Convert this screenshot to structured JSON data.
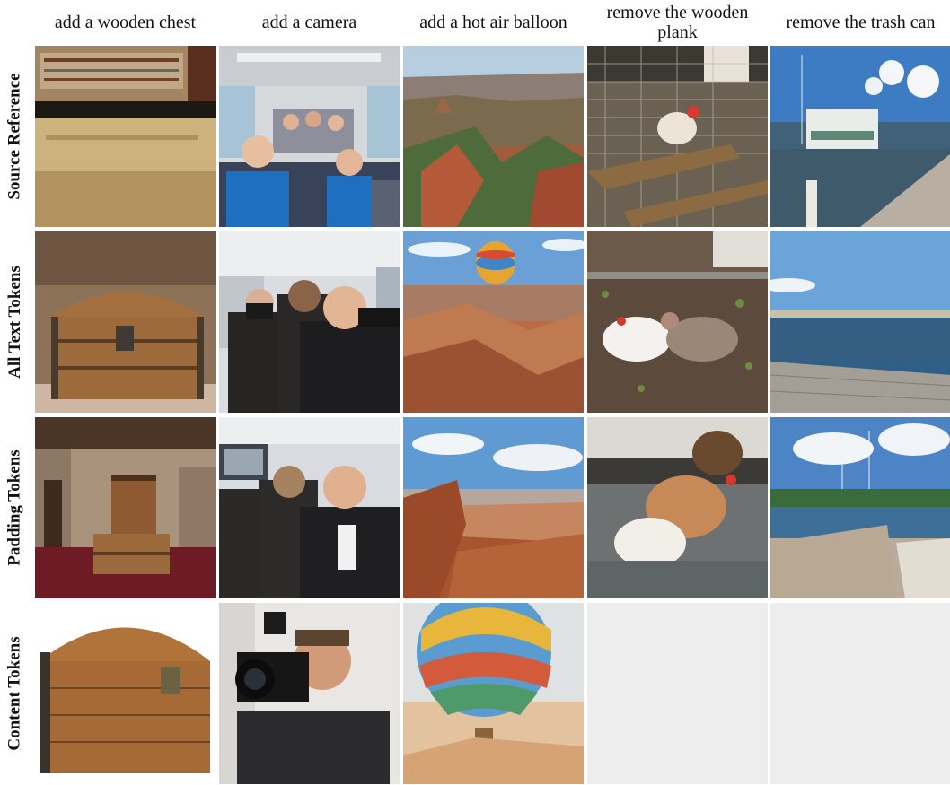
{
  "columns": [
    {
      "label": "add a wooden chest"
    },
    {
      "label": "add a camera"
    },
    {
      "label": "add a hot air balloon"
    },
    {
      "label": "remove the wooden plank"
    },
    {
      "label": "remove the trash can"
    }
  ],
  "rows": [
    {
      "label": "Source Reference"
    },
    {
      "label": "All Text Tokens"
    },
    {
      "label": "Padding Tokens"
    },
    {
      "label": "Content Tokens"
    }
  ],
  "cells": [
    [
      "tomb-chamber-photo",
      "bus-passengers-photo",
      "canyon-photo",
      "chicken-coop-photo",
      "marina-dock-photo"
    ],
    [
      "wooden-chest-photo",
      "camera-photographers-photo",
      "canyon-balloon-photo",
      "chickens-dirt-photo",
      "pier-sea-photo"
    ],
    [
      "chamber-chest-photo",
      "bus-camera-photo",
      "canyon-clouds-photo",
      "hens-metal-photo",
      "marina-pier-photo"
    ],
    [
      "chest-isolated-photo",
      "photographer-photo",
      "balloon-desert-photo",
      "blank-gray-image",
      "blank-gray-image"
    ]
  ]
}
